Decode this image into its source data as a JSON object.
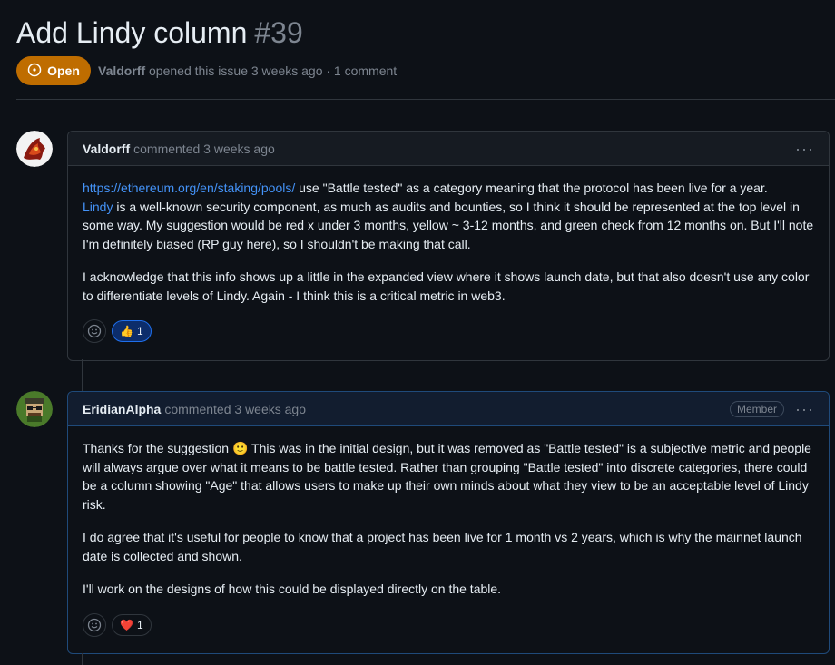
{
  "issue": {
    "title": "Add Lindy column",
    "number": "#39",
    "status": "Open",
    "author": "Valdorff",
    "meta_text": "opened this issue 3 weeks ago · 1 comment"
  },
  "comments": [
    {
      "author": "Valdorff",
      "action": "commented 3 weeks ago",
      "para1_link1": "https://ethereum.org/en/staking/pools/",
      "para1_text1": " use \"Battle tested\" as a category meaning that the protocol has been live for a year.",
      "para1_link2": "Lindy",
      "para1_text2": " is a well-known security component, as much as audits and bounties, so I think it should be represented at the top level in some way. My suggestion would be red x under 3 months, yellow ~ 3-12 months, and green check from 12 months on. But I'll note I'm definitely biased (RP guy here), so I shouldn't be making that call.",
      "para2": "I acknowledge that this info shows up a little in the expanded view where it shows launch date, but that also doesn't use any color to differentiate levels of Lindy. Again - I think this is a critical metric in web3.",
      "reaction_emoji": "👍",
      "reaction_count": "1"
    },
    {
      "author": "EridianAlpha",
      "action": "commented 3 weeks ago",
      "badge": "Member",
      "para1": "Thanks for the suggestion 🙂 This was in the initial design, but it was removed as \"Battle tested\" is a subjective metric and people will always argue over what it means to be battle tested. Rather than grouping \"Battle tested\" into discrete categories, there could be a column showing \"Age\" that allows users to make up their own minds about what they view to be an acceptable level of Lindy risk.",
      "para2": "I do agree that it's useful for people to know that a project has been live for 1 month vs 2 years, which is why the mainnet launch date is collected and shown.",
      "para3": "I'll work on the designs of how this could be displayed directly on the table.",
      "reaction_emoji": "❤️",
      "reaction_count": "1"
    }
  ],
  "icons": {
    "open": "issue-open-icon",
    "smiley": "smiley-icon",
    "more": "kebab-horizontal-icon"
  },
  "colors": {
    "open_badge": "#bf6d00",
    "link": "#4493f8",
    "background": "#0d1117"
  }
}
